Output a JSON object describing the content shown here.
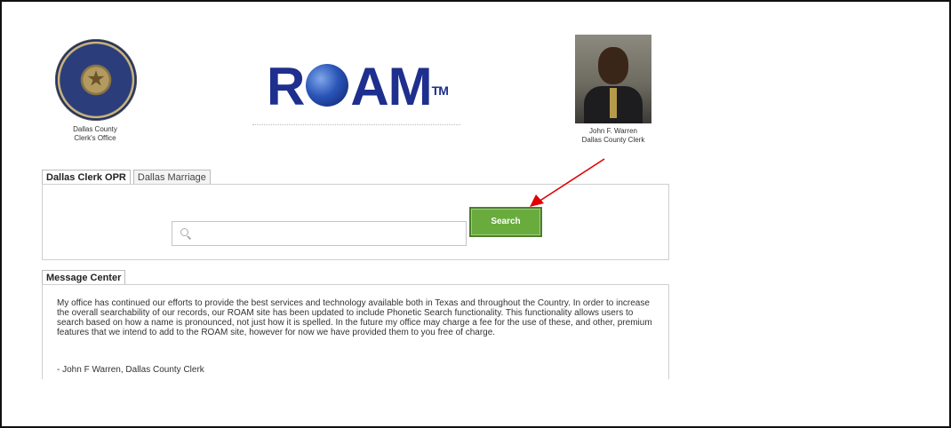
{
  "header": {
    "seal_caption_line1": "Dallas County",
    "seal_caption_line2": "Clerk's Office",
    "logo_text_r": "R",
    "logo_text_am": "AM",
    "logo_tm": "TM",
    "clerk_name": "John F. Warren",
    "clerk_title": "Dallas County Clerk"
  },
  "tabs": [
    {
      "label": "Dallas Clerk OPR",
      "active": true
    },
    {
      "label": "Dallas Marriage",
      "active": false
    }
  ],
  "search": {
    "value": "",
    "placeholder": "",
    "button_label": "Search",
    "button_color": "#6aab3e"
  },
  "message_center": {
    "tab_label": "Message Center",
    "body": "My office has continued our efforts to provide the best services and technology available both in Texas and throughout the Country. In order to increase the overall searchability of our records, our ROAM site has been updated to include Phonetic Search functionality. This functionality allows users to search based on how a name is pronounced, not just how it is spelled. In the future my office may charge a fee for the use of these, and other, premium features that we intend to add to the ROAM site, however for now we have provided them to you free of charge.",
    "signature": "- John F Warren, Dallas County Clerk"
  },
  "colors": {
    "logo_blue": "#1e2f8e",
    "annotation_arrow": "#e00000"
  },
  "icons": {
    "search": "search-icon",
    "annotation": "red-arrow-icon"
  }
}
